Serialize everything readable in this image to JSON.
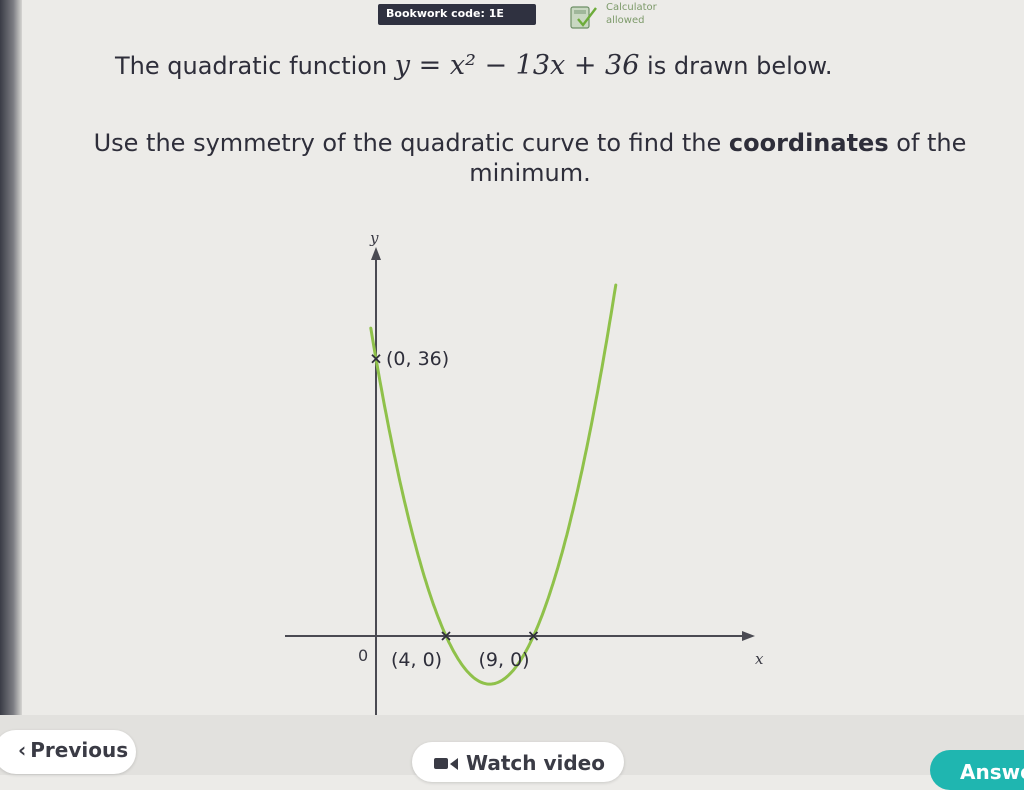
{
  "header": {
    "bookwork_code": "Bookwork code: 1E",
    "calculator_line1": "Calculator",
    "calculator_line2": "allowed"
  },
  "question": {
    "line1_prefix": "The quadratic function ",
    "equation": "y = x² − 13x + 36",
    "line1_suffix": " is drawn below.",
    "line2_start": "Use the symmetry of the quadratic curve to find the ",
    "line2_bold": "coordinates",
    "line2_end": " of the minimum."
  },
  "graph": {
    "x_axis_label": "x",
    "y_axis_label": "y",
    "origin_label": "0",
    "points": [
      {
        "x": 0,
        "y": 36,
        "label": "(0, 36)"
      },
      {
        "x": 4,
        "y": 0,
        "label": "(4, 0)"
      },
      {
        "x": 9,
        "y": 0,
        "label": "(9, 0)"
      }
    ],
    "curve": {
      "a": 1,
      "b": -13,
      "c": 36,
      "x_min": -0.3,
      "x_max": 13.7
    },
    "axis_color": "#4a4a52",
    "curve_color": "#8fc14a"
  },
  "footer": {
    "previous_label": "Previous",
    "watch_video_label": "Watch video",
    "answer_label": "Answer"
  }
}
